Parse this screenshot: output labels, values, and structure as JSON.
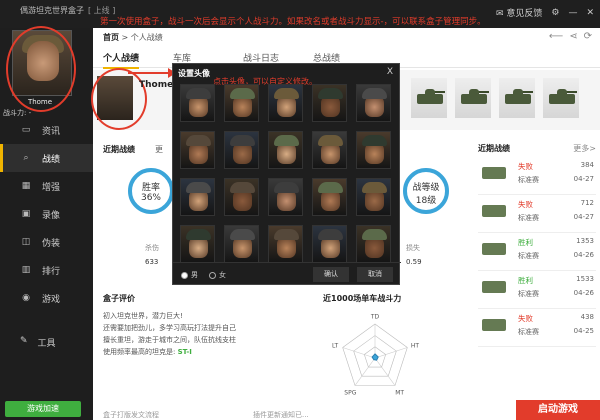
{
  "app": {
    "name": "偶游坦克世界盒子",
    "status_tag": "[ 上线 ]",
    "annotation": "第一次使用盒子，战斗一次后会显示个人战斗力。如果改名或者战斗力显示-，可以联系盒子管理同步。",
    "feedback": "意见反馈"
  },
  "user": {
    "name": "Thome",
    "power_label": "战斗力:",
    "power_value": "-"
  },
  "sidebar": {
    "items": [
      {
        "label": "资讯",
        "icon": "tv-icon"
      },
      {
        "label": "战绩",
        "icon": "search-icon"
      },
      {
        "label": "增强",
        "icon": "grid-icon"
      },
      {
        "label": "录像",
        "icon": "film-icon"
      },
      {
        "label": "伪装",
        "icon": "camo-icon"
      },
      {
        "label": "排行",
        "icon": "bar-chart-icon"
      },
      {
        "label": "游戏",
        "icon": "gamepad-icon"
      }
    ],
    "active": 1,
    "tools_label": "工具",
    "game_button": "游戏加速"
  },
  "breadcrumb": {
    "home": "首页",
    "sep": ">",
    "current": "个人战绩"
  },
  "tabs": [
    "个人战绩",
    "车库",
    "战斗日志",
    "总战绩"
  ],
  "player_short": "Thome",
  "stats": {
    "recent_title": "近期战绩",
    "more_btn": "更",
    "winrate_label": "胜率",
    "winrate_value": "36%",
    "level_label": "战等级",
    "level_value": "18级",
    "left_label": "杀伤",
    "left_value": "633",
    "right_label": "损失",
    "right_value": "0.59"
  },
  "evaluation": {
    "title": "盒子评价",
    "lines": [
      "初入坦克世界，潜力巨大!",
      "还需要加把劲儿，多学习高玩打法提升自己",
      "擅长重坦，游走于城市之间，队伍抗线支柱"
    ],
    "fav_prefix": "使用频率最高的坦克是:",
    "fav_tank": "ST-I"
  },
  "radar": {
    "title": "近1000场单车战斗力",
    "axes": [
      "TD",
      "HT",
      "MT",
      "SPG",
      "LT"
    ],
    "values": [
      0.12,
      0.1,
      0.08,
      0.06,
      0.09
    ]
  },
  "recent_panel": {
    "title": "近期战绩",
    "more": "更多>",
    "rows": [
      {
        "result": "失败",
        "mode": "标准赛",
        "num": "384",
        "date": "04-27",
        "win": false
      },
      {
        "result": "失败",
        "mode": "标准赛",
        "num": "712",
        "date": "04-27",
        "win": false
      },
      {
        "result": "胜利",
        "mode": "标准赛",
        "num": "1353",
        "date": "04-26",
        "win": true
      },
      {
        "result": "胜利",
        "mode": "标准赛",
        "num": "1533",
        "date": "04-26",
        "win": true
      },
      {
        "result": "失败",
        "mode": "标准赛",
        "num": "438",
        "date": "04-25",
        "win": false
      }
    ]
  },
  "bottom": {
    "left": "盒子打版发文流程",
    "mid": "插件更新通知已..."
  },
  "promo": "启动游戏",
  "dialog": {
    "title": "设置头像",
    "close": "X",
    "hint": "点击头像，可以自定义修改。",
    "male": "男",
    "female": "女",
    "ok": "确认",
    "cancel": "取消"
  },
  "colors": {
    "accent": "#f0b400",
    "red": "#e23c2b",
    "green": "#3fae3f",
    "ring": "#3ba5d9"
  }
}
